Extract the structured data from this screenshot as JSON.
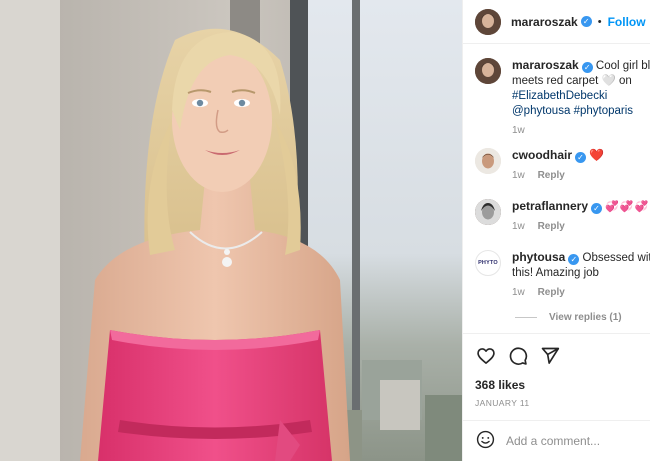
{
  "post": {
    "author": "mararoszak",
    "dot": "•",
    "follow_label": "Follow",
    "caption": {
      "username": "mararoszak",
      "text_prefix": " Cool girl blowout meets red carpet ",
      "white_heart": "🤍",
      "text_on": " on",
      "hashtag_1": "#ElizabethDebecki",
      "mention": "@phytousa",
      "hashtag_2": "#phytoparis",
      "age": "1w"
    },
    "comments": [
      {
        "username": "cwoodhair",
        "text": "❤️",
        "age": "1w",
        "reply_label": "Reply"
      },
      {
        "username": "petraflannery",
        "text": "💞💞💞",
        "age": "1w",
        "reply_label": "Reply"
      },
      {
        "username": "phytousa",
        "text": " Obsessed with this! Amazing job",
        "age": "1w",
        "reply_label": "Reply",
        "avatar_text": "PHYTO"
      }
    ],
    "view_replies_label": "View replies (1)",
    "likes": "368 likes",
    "date": "JANUARY 11",
    "add_comment_placeholder": "Add a comment...",
    "verified_mark": "✓",
    "icons": [
      "heart-icon",
      "comment-icon",
      "share-icon",
      "emoji-icon"
    ],
    "colors": {
      "follow_blue": "#0095f6",
      "verified_blue": "#3897f0",
      "muted_gray": "#8e8e8e",
      "dress_pink": "#e8407a"
    }
  }
}
